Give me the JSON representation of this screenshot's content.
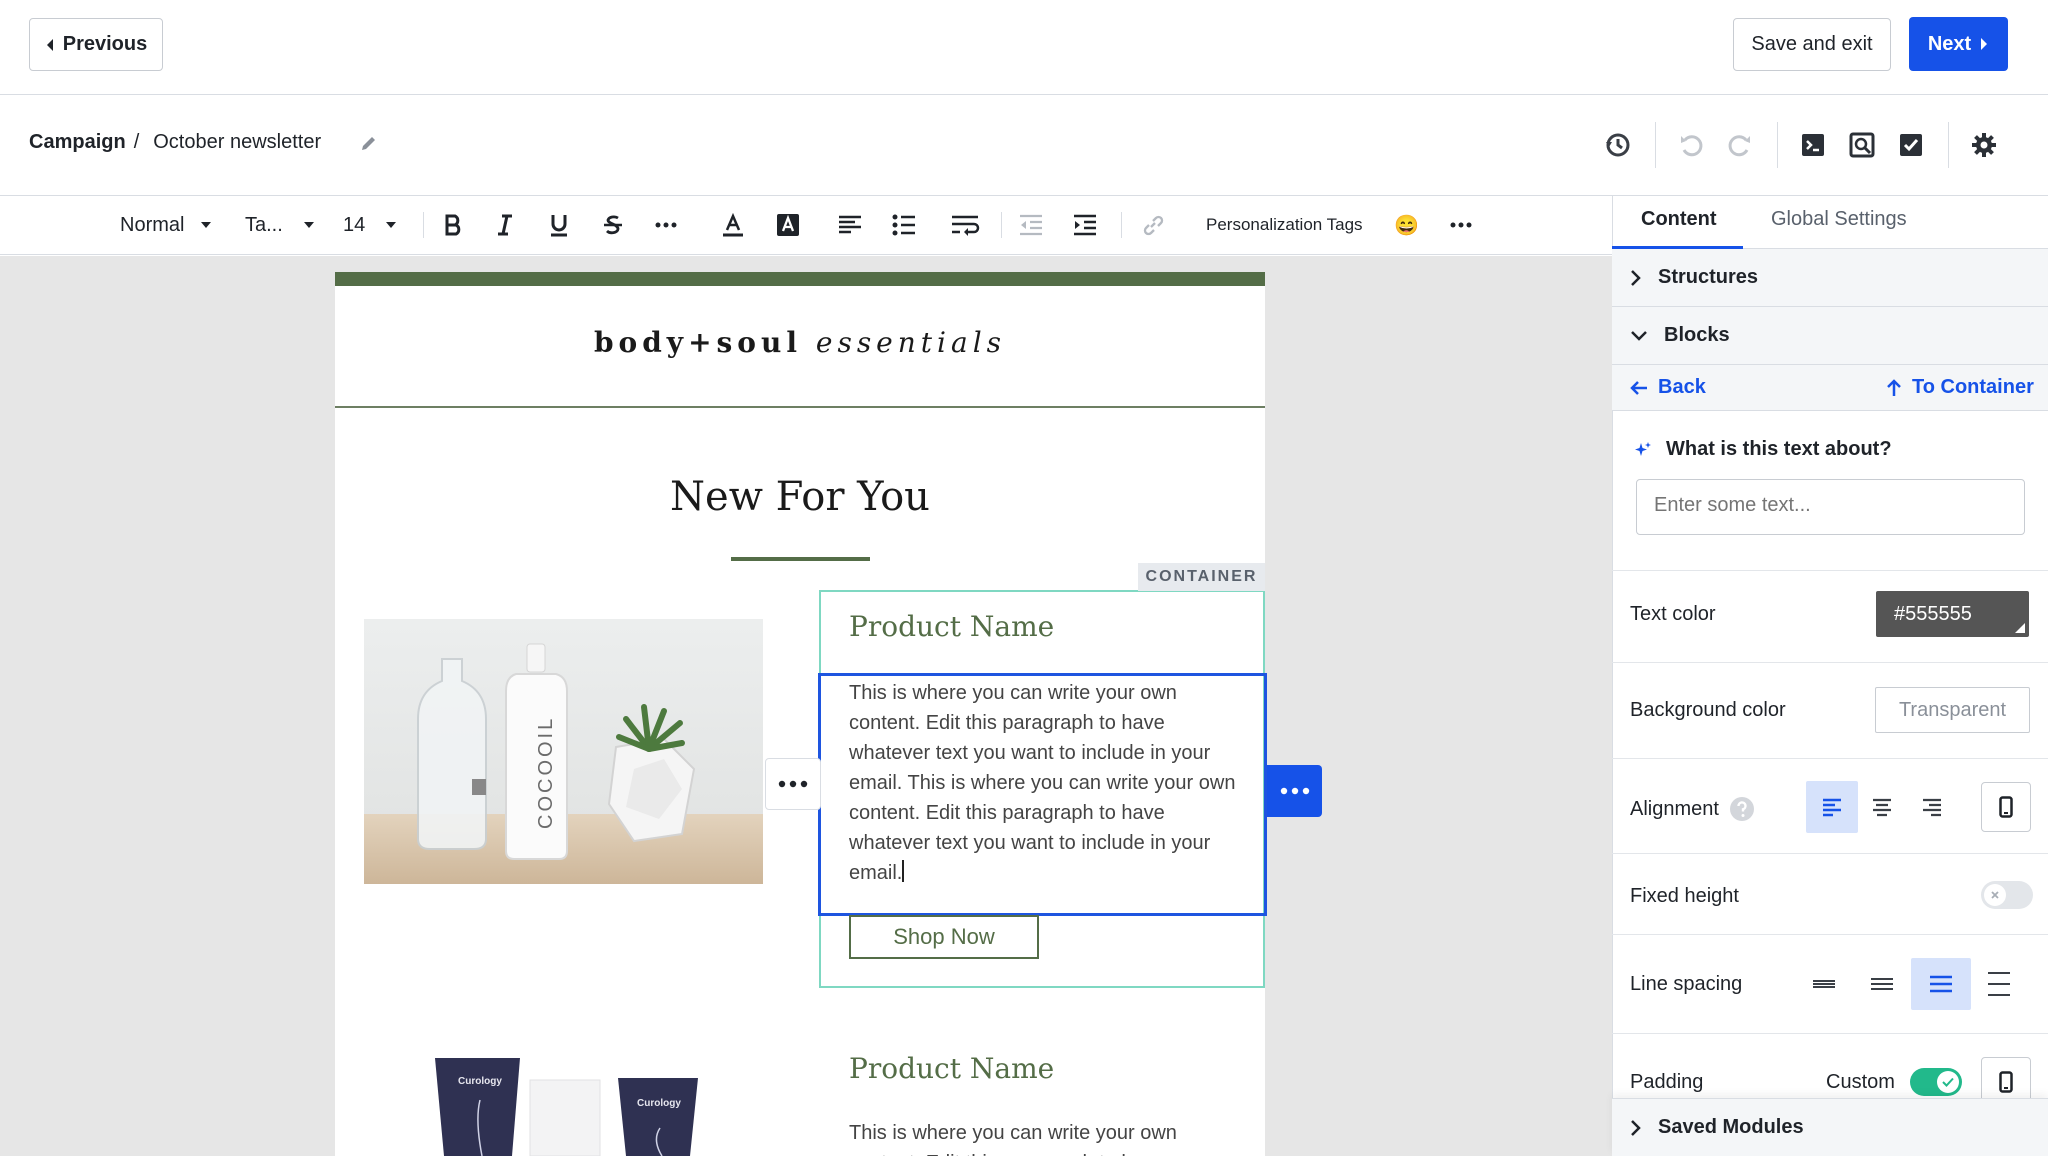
{
  "topbar": {
    "previous_label": "Previous",
    "save_exit_label": "Save and exit",
    "next_label": "Next"
  },
  "breadcrumb": {
    "root": "Campaign",
    "separator": "/",
    "current": "October newsletter"
  },
  "toolbar": {
    "style_select": "Normal",
    "font_select": "Ta...",
    "size_select": "14",
    "personalization_label": "Personalization Tags",
    "emoji": "😄"
  },
  "email": {
    "brand_bold": "body+soul",
    "brand_italic": "essentials",
    "headline": "New For You",
    "container_tag": "CONTAINER",
    "product1_name": "Product Name",
    "product1_text": "This is where you can write your own content. Edit this paragraph to have whatever text you want to include in your email. This is where you can write your own content. Edit this paragraph to have whatever text you want to include in your email.",
    "shop_now": "Shop Now",
    "product2_name": "Product Name",
    "product2_text": "This is where you can write your own content. Edit this paragraph to have",
    "bottle_label": "COCOOIL",
    "tube_label": "Curology"
  },
  "panel": {
    "tabs": [
      "Content",
      "Global Settings"
    ],
    "structures_label": "Structures",
    "blocks_label": "Blocks",
    "back_label": "Back",
    "to_container_label": "To Container",
    "ai_label": "What is this text about?",
    "ai_placeholder": "Enter some text...",
    "text_color_label": "Text color",
    "text_color_value": "#555555",
    "bg_color_label": "Background color",
    "bg_color_value": "Transparent",
    "alignment_label": "Alignment",
    "fixed_height_label": "Fixed height",
    "line_spacing_label": "Line spacing",
    "padding_label": "Padding",
    "padding_mode": "Custom",
    "saved_modules_label": "Saved Modules"
  },
  "colors": {
    "accent": "#1652e8",
    "brand_green": "#546d47",
    "container_outline": "#7fd8c2",
    "toggle_on": "#22b98b"
  }
}
